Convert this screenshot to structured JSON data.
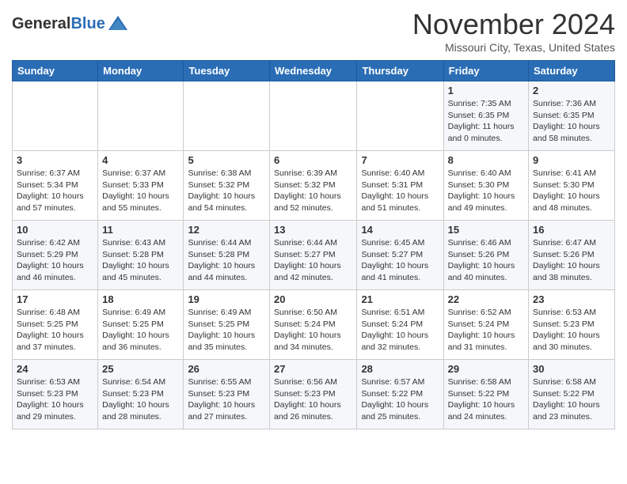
{
  "header": {
    "logo_general": "General",
    "logo_blue": "Blue",
    "month_title": "November 2024",
    "location": "Missouri City, Texas, United States"
  },
  "weekdays": [
    "Sunday",
    "Monday",
    "Tuesday",
    "Wednesday",
    "Thursday",
    "Friday",
    "Saturday"
  ],
  "weeks": [
    [
      {
        "day": "",
        "info": ""
      },
      {
        "day": "",
        "info": ""
      },
      {
        "day": "",
        "info": ""
      },
      {
        "day": "",
        "info": ""
      },
      {
        "day": "",
        "info": ""
      },
      {
        "day": "1",
        "info": "Sunrise: 7:35 AM\nSunset: 6:35 PM\nDaylight: 11 hours and 0 minutes."
      },
      {
        "day": "2",
        "info": "Sunrise: 7:36 AM\nSunset: 6:35 PM\nDaylight: 10 hours and 58 minutes."
      }
    ],
    [
      {
        "day": "3",
        "info": "Sunrise: 6:37 AM\nSunset: 5:34 PM\nDaylight: 10 hours and 57 minutes."
      },
      {
        "day": "4",
        "info": "Sunrise: 6:37 AM\nSunset: 5:33 PM\nDaylight: 10 hours and 55 minutes."
      },
      {
        "day": "5",
        "info": "Sunrise: 6:38 AM\nSunset: 5:32 PM\nDaylight: 10 hours and 54 minutes."
      },
      {
        "day": "6",
        "info": "Sunrise: 6:39 AM\nSunset: 5:32 PM\nDaylight: 10 hours and 52 minutes."
      },
      {
        "day": "7",
        "info": "Sunrise: 6:40 AM\nSunset: 5:31 PM\nDaylight: 10 hours and 51 minutes."
      },
      {
        "day": "8",
        "info": "Sunrise: 6:40 AM\nSunset: 5:30 PM\nDaylight: 10 hours and 49 minutes."
      },
      {
        "day": "9",
        "info": "Sunrise: 6:41 AM\nSunset: 5:30 PM\nDaylight: 10 hours and 48 minutes."
      }
    ],
    [
      {
        "day": "10",
        "info": "Sunrise: 6:42 AM\nSunset: 5:29 PM\nDaylight: 10 hours and 46 minutes."
      },
      {
        "day": "11",
        "info": "Sunrise: 6:43 AM\nSunset: 5:28 PM\nDaylight: 10 hours and 45 minutes."
      },
      {
        "day": "12",
        "info": "Sunrise: 6:44 AM\nSunset: 5:28 PM\nDaylight: 10 hours and 44 minutes."
      },
      {
        "day": "13",
        "info": "Sunrise: 6:44 AM\nSunset: 5:27 PM\nDaylight: 10 hours and 42 minutes."
      },
      {
        "day": "14",
        "info": "Sunrise: 6:45 AM\nSunset: 5:27 PM\nDaylight: 10 hours and 41 minutes."
      },
      {
        "day": "15",
        "info": "Sunrise: 6:46 AM\nSunset: 5:26 PM\nDaylight: 10 hours and 40 minutes."
      },
      {
        "day": "16",
        "info": "Sunrise: 6:47 AM\nSunset: 5:26 PM\nDaylight: 10 hours and 38 minutes."
      }
    ],
    [
      {
        "day": "17",
        "info": "Sunrise: 6:48 AM\nSunset: 5:25 PM\nDaylight: 10 hours and 37 minutes."
      },
      {
        "day": "18",
        "info": "Sunrise: 6:49 AM\nSunset: 5:25 PM\nDaylight: 10 hours and 36 minutes."
      },
      {
        "day": "19",
        "info": "Sunrise: 6:49 AM\nSunset: 5:25 PM\nDaylight: 10 hours and 35 minutes."
      },
      {
        "day": "20",
        "info": "Sunrise: 6:50 AM\nSunset: 5:24 PM\nDaylight: 10 hours and 34 minutes."
      },
      {
        "day": "21",
        "info": "Sunrise: 6:51 AM\nSunset: 5:24 PM\nDaylight: 10 hours and 32 minutes."
      },
      {
        "day": "22",
        "info": "Sunrise: 6:52 AM\nSunset: 5:24 PM\nDaylight: 10 hours and 31 minutes."
      },
      {
        "day": "23",
        "info": "Sunrise: 6:53 AM\nSunset: 5:23 PM\nDaylight: 10 hours and 30 minutes."
      }
    ],
    [
      {
        "day": "24",
        "info": "Sunrise: 6:53 AM\nSunset: 5:23 PM\nDaylight: 10 hours and 29 minutes."
      },
      {
        "day": "25",
        "info": "Sunrise: 6:54 AM\nSunset: 5:23 PM\nDaylight: 10 hours and 28 minutes."
      },
      {
        "day": "26",
        "info": "Sunrise: 6:55 AM\nSunset: 5:23 PM\nDaylight: 10 hours and 27 minutes."
      },
      {
        "day": "27",
        "info": "Sunrise: 6:56 AM\nSunset: 5:23 PM\nDaylight: 10 hours and 26 minutes."
      },
      {
        "day": "28",
        "info": "Sunrise: 6:57 AM\nSunset: 5:22 PM\nDaylight: 10 hours and 25 minutes."
      },
      {
        "day": "29",
        "info": "Sunrise: 6:58 AM\nSunset: 5:22 PM\nDaylight: 10 hours and 24 minutes."
      },
      {
        "day": "30",
        "info": "Sunrise: 6:58 AM\nSunset: 5:22 PM\nDaylight: 10 hours and 23 minutes."
      }
    ]
  ]
}
